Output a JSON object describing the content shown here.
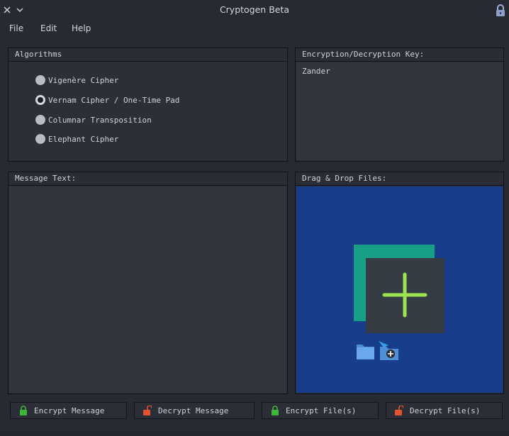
{
  "window": {
    "title": "Cryptogen Beta",
    "close_icon": "close-icon",
    "chevron_icon": "chevron-down-icon",
    "lock_icon": "lock-icon"
  },
  "menu": {
    "file": "File",
    "edit": "Edit",
    "help": "Help"
  },
  "algorithms": {
    "title": "Algorithms",
    "options": [
      {
        "label": "Vigenère Cipher",
        "checked": false
      },
      {
        "label": "Vernam Cipher / One-Time Pad",
        "checked": true
      },
      {
        "label": "Columnar Transposition",
        "checked": false
      },
      {
        "label": "Elephant Cipher",
        "checked": false
      }
    ]
  },
  "key": {
    "title": "Encryption/Decryption Key:",
    "value": "Zander"
  },
  "message": {
    "title": "Message Text:",
    "value": ""
  },
  "drop": {
    "title": "Drag & Drop Files:",
    "icon": "add-files-icon"
  },
  "buttons": {
    "encrypt_message": "Encrypt Message",
    "decrypt_message": "Decrypt Message",
    "encrypt_files": "Encrypt File(s)",
    "decrypt_files": "Decrypt File(s)"
  },
  "colors": {
    "background": "#272a33",
    "drop_zone": "#183d8a",
    "lock_green": "#3fb83a",
    "lock_red": "#e4522e",
    "plus_green": "#9be34f",
    "teal_card": "#17a085"
  }
}
